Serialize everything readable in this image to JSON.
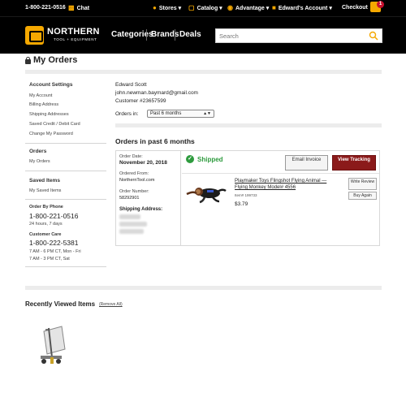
{
  "topbar": {
    "phone": "1-800-221-0516",
    "chat_label": "Chat",
    "stores_label": "Stores",
    "catalog_label": "Catalog",
    "advantage_label": "Advantage",
    "account_label": "Edward's Account",
    "checkout_label": "Checkout",
    "cart_count": "1"
  },
  "header": {
    "logo_name": "NORTHERN",
    "logo_sub": "TOOL + EQUIPMENT",
    "nav": [
      "Categories",
      "Brands",
      "Deals"
    ],
    "search_placeholder": "Search"
  },
  "page_title": "My Orders",
  "sidebar": {
    "account_settings": {
      "heading": "Account Settings",
      "links": [
        "My Account",
        "Billing Address",
        "Shipping Addresses",
        "Saved Credit / Debit Card",
        "Change My Password"
      ]
    },
    "orders": {
      "heading": "Orders",
      "links": [
        "My Orders"
      ]
    },
    "saved_items": {
      "heading": "Saved Items",
      "links": [
        "My Saved Items"
      ]
    },
    "order_by_phone": {
      "heading": "Order By Phone",
      "phone": "1-800-221-0516",
      "hours": "24 hours, 7 days"
    },
    "customer_care": {
      "heading": "Customer Care",
      "phone": "1-800-222-5381",
      "hours": [
        "7 AM - 6 PM CT, Mon - Fri",
        "7 AM - 3 PM CT, Sat"
      ]
    }
  },
  "customer": {
    "name": "Edward Scott",
    "email": "john.newman.baymard@gmail.com",
    "customer_number": "Customer #23657599"
  },
  "filter": {
    "label": "Orders in:",
    "selected": "Past 6 months"
  },
  "orders_heading": "Orders in past 6 months",
  "order": {
    "date_label": "Order Date:",
    "date": "November 20, 2018",
    "from_label": "Ordered From:",
    "from": "NorthernTool.com",
    "number_label": "Order Number:",
    "number": "58292901",
    "shipping_label": "Shipping Address:",
    "status": "Shipped",
    "email_invoice_label": "Email Invoice",
    "view_tracking_label": "View Tracking",
    "product": {
      "name": "Playmaker Toys Flingshot Flying Animal — Flying Monkey Model# 4556",
      "item": "Item# 199733",
      "price": "$3.79",
      "write_review_label": "Write Review",
      "buy_again_label": "Buy Again"
    }
  },
  "recently_viewed": {
    "heading": "Recently Viewed Items",
    "remove_all_label": "(Remove All)"
  },
  "colors": {
    "accent": "#f5a800",
    "tracking_button": "#8b1a1a",
    "shipped": "#2e9b3e",
    "header_bg": "#000000"
  }
}
